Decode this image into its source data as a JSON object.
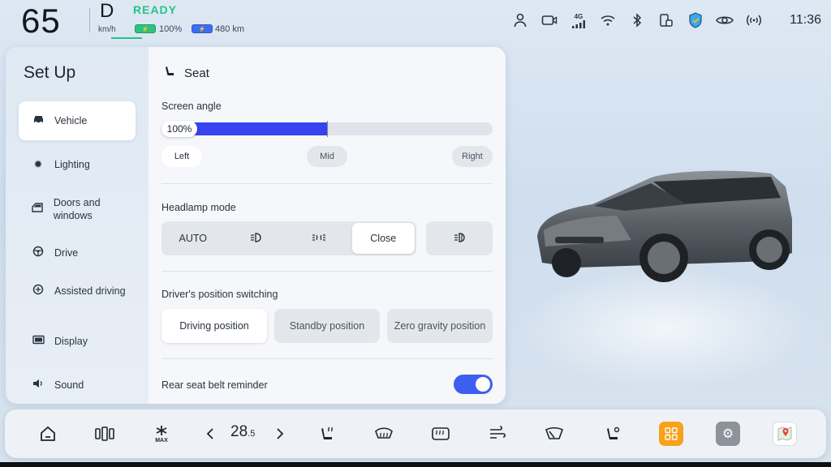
{
  "status": {
    "speed": "65",
    "speed_unit": "km/h",
    "gear": "D",
    "ready": "READY",
    "battery_pct": "100%",
    "range": "480 km",
    "time": "11:36",
    "icons": [
      "person-icon",
      "camera-icon",
      "signal-4g-icon",
      "wifi-icon",
      "bluetooth-icon",
      "phone-link-icon",
      "shield-icon",
      "eye-icon",
      "broadcast-icon"
    ],
    "net_label": "4G"
  },
  "panel": {
    "title": "Set Up",
    "sidebar": [
      {
        "label": "Vehicle",
        "icon": "car-icon"
      },
      {
        "label": "Lighting",
        "icon": "light-icon"
      },
      {
        "label": "Doors and windows",
        "icon": "door-icon"
      },
      {
        "label": "Drive",
        "icon": "steering-wheel-icon"
      },
      {
        "label": "Assisted driving",
        "icon": "assist-icon"
      },
      {
        "label": "Display",
        "icon": "display-icon"
      },
      {
        "label": "Sound",
        "icon": "speaker-icon"
      }
    ],
    "section": "Seat",
    "screen_angle": {
      "label": "Screen angle",
      "value": "100%",
      "level": 0.5,
      "options": [
        "Left",
        "Mid",
        "Right"
      ]
    },
    "headlamp": {
      "label": "Headlamp mode",
      "options": [
        "AUTO",
        "",
        "",
        "Close"
      ],
      "selected": "Close"
    },
    "position": {
      "label": "Driver's position switching",
      "options": [
        "Driving position",
        "Standby position",
        "Zero gravity position"
      ],
      "selected": "Driving position"
    },
    "belt": {
      "label": "Rear seat belt reminder",
      "on": true
    }
  },
  "dock": {
    "temperature": "28",
    "temperature_decimal": ".5",
    "accent": "#3742f0"
  }
}
